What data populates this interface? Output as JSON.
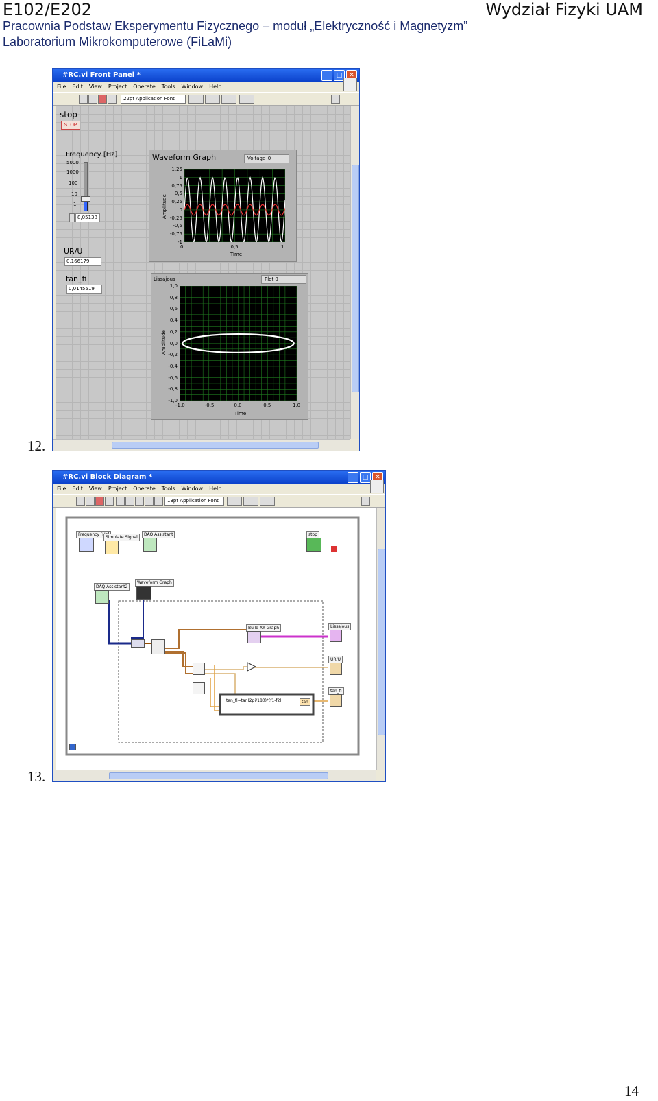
{
  "header": {
    "code": "E102/E202",
    "faculty": "Wydział Fizyki UAM",
    "course": "Pracownia Podstaw Eksperymentu Fizycznego – moduł „Elektryczność i Magnetyzm”",
    "lab": "Laboratorium Mikrokomputerowe (FiLaMi)"
  },
  "captions": {
    "fig12": "12.",
    "fig13": "13."
  },
  "page_number": "14",
  "front_panel": {
    "title": "#RC.vi Front Panel *",
    "menu": [
      "File",
      "Edit",
      "View",
      "Project",
      "Operate",
      "Tools",
      "Window",
      "Help"
    ],
    "font_select": "22pt Application Font",
    "stop_label": "stop",
    "stop_button": "STOP",
    "frequency_label": "Frequency [Hz]",
    "slider_ticks": [
      "5000",
      "1000",
      "100",
      "10",
      "1"
    ],
    "frequency_value": "8,05138",
    "urU_label": "UR/U",
    "urU_value": "0,166179",
    "tanfi_label": "tan_fi",
    "tanfi_value": "0,0145519",
    "waveform": {
      "title": "Waveform Graph",
      "legend": "Voltage_0",
      "ylabel": "Amplitude",
      "xlabel": "Time",
      "yticks": [
        "1,25",
        "1",
        "0,75",
        "0,5",
        "0,25",
        "0",
        "-0,25",
        "-0,5",
        "-0,75",
        "-1"
      ],
      "xticks": [
        "0",
        "0,5",
        "1"
      ]
    },
    "lissajous": {
      "title": "Lissajous",
      "legend": "Plot 0",
      "ylabel": "Amplitude",
      "xlabel": "Time",
      "yticks": [
        "1,0",
        "0,8",
        "0,6",
        "0,4",
        "0,2",
        "0,0",
        "-0,2",
        "-0,4",
        "-0,6",
        "-0,8",
        "-1,0"
      ],
      "xticks": [
        "-1,0",
        "-0,5",
        "0,0",
        "0,5",
        "1,0"
      ]
    }
  },
  "block_diagram": {
    "title": "#RC.vi Block Diagram *",
    "menu": [
      "File",
      "Edit",
      "View",
      "Project",
      "Operate",
      "Tools",
      "Window",
      "Help"
    ],
    "font_select": "13pt Application Font",
    "nodes": {
      "frequency": "Frequency [Hz]",
      "simulate": "Simulate Signal",
      "daq1": "DAQ Assistant",
      "stop": "stop",
      "daq2": "DAQ Assistant2",
      "waveform": "Waveform Graph",
      "buildxy": "Build XY Graph",
      "lissajous": "Lissajous",
      "urU": "UR/U",
      "tanfi": "tan_fi",
      "formula": "tan_fi=tan(2pi/180)*(f1-f2);",
      "tan_out": "tan"
    }
  }
}
